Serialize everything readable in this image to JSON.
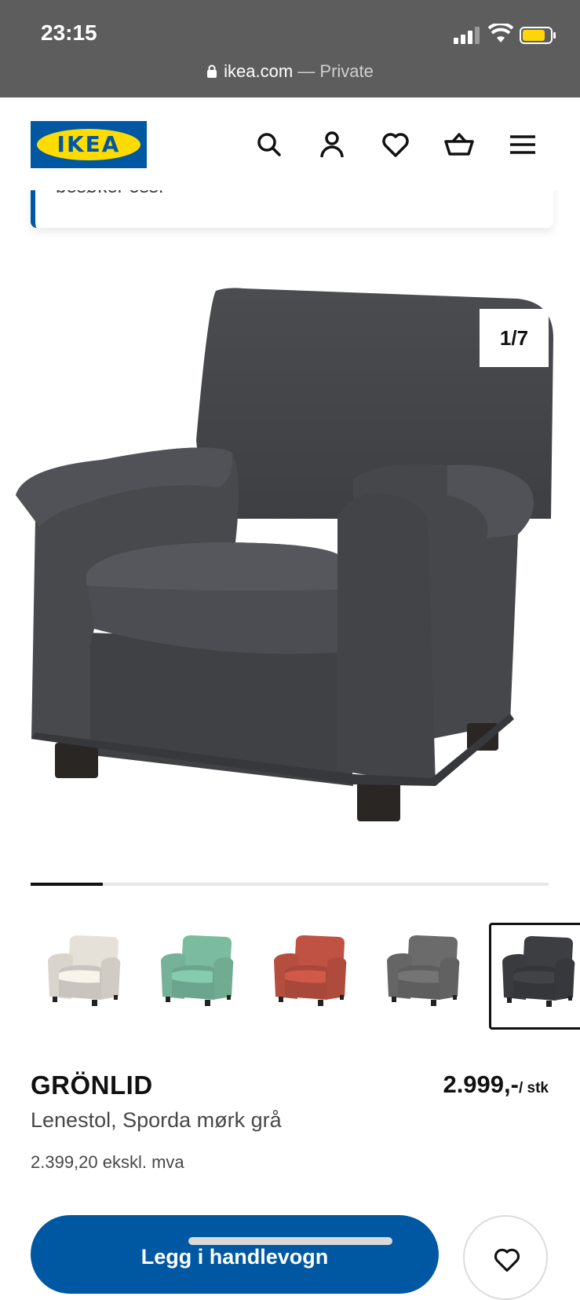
{
  "status": {
    "time": "23:15"
  },
  "browser": {
    "domain": "ikea.com",
    "suffix": " — Private"
  },
  "header": {
    "logo_text": "IKEA"
  },
  "notice": {
    "text": "besøker oss."
  },
  "gallery": {
    "counter": "1/7",
    "progress": 0.14
  },
  "variants": [
    {
      "color": "#ece8df",
      "name": "white"
    },
    {
      "color": "#7fc2a6",
      "name": "green"
    },
    {
      "color": "#c65545",
      "name": "red"
    },
    {
      "color": "#6e6e6e",
      "name": "grey"
    },
    {
      "color": "#3e4043",
      "name": "dark-grey"
    }
  ],
  "product": {
    "name": "GRÖNLID",
    "price": "2.999,-",
    "unit": "/ stk",
    "description": "Lenestol, Sporda mørk grå",
    "excl_vat": "2.399,20 ekskl. mva"
  },
  "actions": {
    "add_to_cart": "Legg i handlevogn"
  }
}
